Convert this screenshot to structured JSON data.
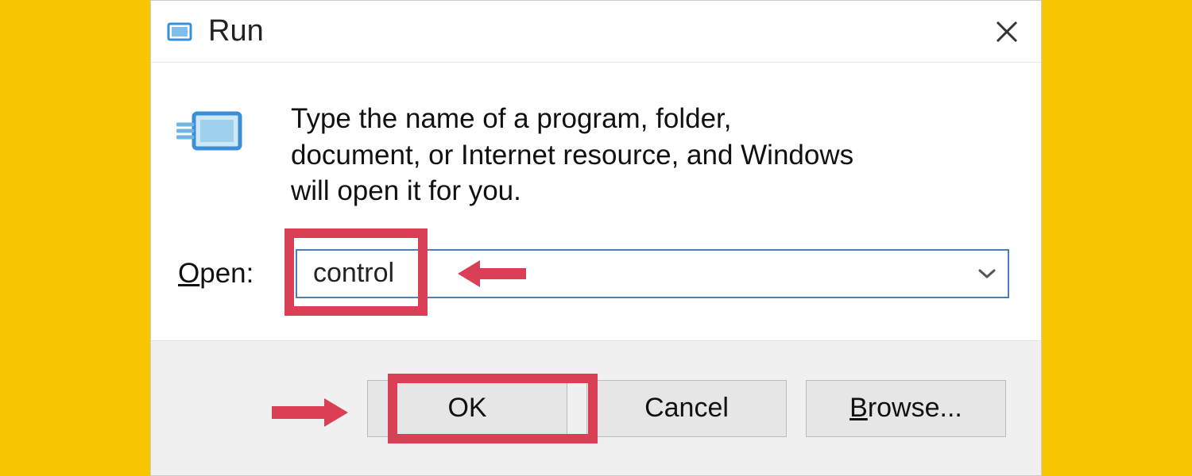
{
  "dialog": {
    "title": "Run",
    "description": "Type the name of a program, folder, document, or Internet resource, and Windows will open it for you.",
    "open_label_prefix": "O",
    "open_label_rest": "pen:",
    "input_value": "control",
    "buttons": {
      "ok": "OK",
      "cancel": "Cancel",
      "browse_prefix": "B",
      "browse_rest": "rowse..."
    }
  },
  "annotations": {
    "highlight_color": "#d94055"
  }
}
